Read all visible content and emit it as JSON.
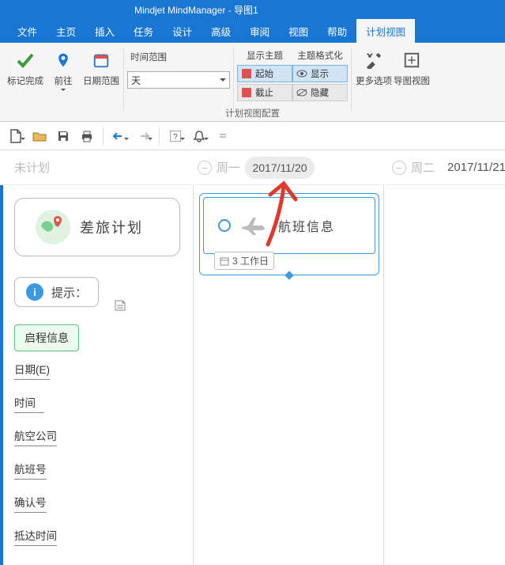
{
  "title": "Mindjet MindManager - 导图1",
  "menu": {
    "items": [
      "文件",
      "主页",
      "插入",
      "任务",
      "设计",
      "高级",
      "审阅",
      "视图",
      "帮助",
      "计划视图"
    ],
    "active_index": 9
  },
  "ribbon": {
    "mark_complete": "标记完成",
    "goto": "前往",
    "date_range": "日期范围",
    "time_range_label": "时间范围",
    "time_range_value": "天",
    "show_topic": "显示主题",
    "start": "起始",
    "deadline": "截止",
    "topic_format": "主题格式化",
    "show": "显示",
    "hide": "隐藏",
    "more_options": "更多选项",
    "mindmap_view": "导图视图",
    "footer": "计划视图配置"
  },
  "calendar": {
    "unplanned": "未计划",
    "day1_label": "周一",
    "day1_date": "2017/11/20",
    "day2_label": "周二",
    "day2_date": "2017/11/21"
  },
  "cards": {
    "travel_plan": "差旅计划",
    "flight_info": "航班信息",
    "work_days": "3 工作日",
    "hint": "提示：",
    "departure_btn": "启程信息"
  },
  "fields": [
    "日期(E)",
    "时间",
    "航空公司",
    "航班号",
    "确认号",
    "抵达时间"
  ]
}
